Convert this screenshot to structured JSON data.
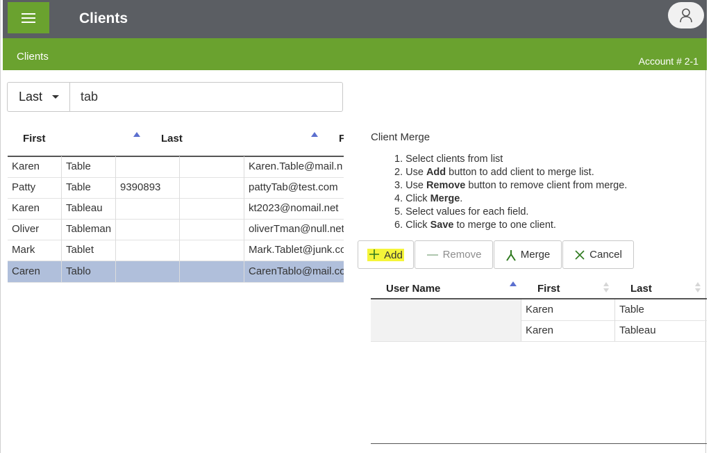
{
  "header": {
    "title": "Clients",
    "menu_icon": "hamburger-icon",
    "user_icon": "user-icon"
  },
  "subheader": {
    "breadcrumb": "Clients",
    "account": "Account # 2-1"
  },
  "search": {
    "field": "Last",
    "query": "tab"
  },
  "client_table": {
    "columns": [
      "First",
      "Last",
      "F"
    ],
    "rows": [
      {
        "first": "Karen",
        "last": "Table",
        "phone": "",
        "extra": "",
        "email": "Karen.Table@mail.n",
        "selected": false
      },
      {
        "first": "Patty",
        "last": "Table",
        "phone": "9390893",
        "extra": "",
        "email": "pattyTab@test.com",
        "selected": false
      },
      {
        "first": "Karen",
        "last": "Tableau",
        "phone": "",
        "extra": "",
        "email": "kt2023@nomail.net",
        "selected": false
      },
      {
        "first": "Oliver",
        "last": "Tableman",
        "phone": "",
        "extra": "",
        "email": "oliverTman@null.net",
        "selected": false
      },
      {
        "first": "Mark",
        "last": "Tablet",
        "phone": "",
        "extra": "",
        "email": "Mark.Tablet@junk.co",
        "selected": false
      },
      {
        "first": "Caren",
        "last": "Tablo",
        "phone": "",
        "extra": "",
        "email": "CarenTablo@mail.co",
        "selected": true
      }
    ]
  },
  "merge": {
    "title": "Client Merge",
    "steps": [
      {
        "n": "1.",
        "pre": "Select clients from list",
        "bold": "",
        "post": ""
      },
      {
        "n": "2.",
        "pre": "Use ",
        "bold": "Add",
        "post": " button to add client to merge list."
      },
      {
        "n": "3.",
        "pre": "Use ",
        "bold": "Remove",
        "post": " button to remove client from merge."
      },
      {
        "n": "4.",
        "pre": "Click ",
        "bold": "Merge",
        "post": "."
      },
      {
        "n": "5.",
        "pre": "Select values for each field.",
        "bold": "",
        "post": ""
      },
      {
        "n": "6.",
        "pre": "Click ",
        "bold": "Save",
        "post": " to merge to one client."
      }
    ],
    "buttons": {
      "add": "Add",
      "remove": "Remove",
      "merge": "Merge",
      "cancel": "Cancel"
    },
    "table": {
      "columns": [
        "User Name",
        "First",
        "Last"
      ],
      "rows": [
        {
          "user_name": "",
          "first": "Karen",
          "last": "Table"
        },
        {
          "user_name": "",
          "first": "Karen",
          "last": "Tableau"
        }
      ]
    }
  },
  "colors": {
    "header_bg": "#5b5e63",
    "accent_green": "#6aa22f",
    "selected_row": "#b0bfdb",
    "highlight": "#f5f53a",
    "sort_indicator": "#5b6fcf"
  }
}
